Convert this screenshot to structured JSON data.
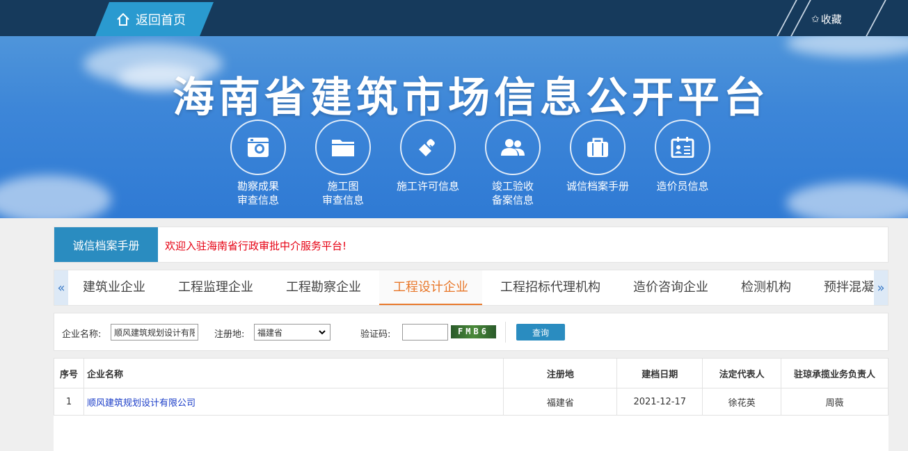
{
  "topbar": {
    "home_label": "返回首页",
    "favorite_label": "收藏"
  },
  "banner": {
    "title": "海南省建筑市场信息公开平台",
    "nav": [
      {
        "label": "勘察成果\n审查信息",
        "icon": "camera-icon"
      },
      {
        "label": "施工图\n审查信息",
        "icon": "folder-icon"
      },
      {
        "label": "施工许可信息",
        "icon": "stamp-icon"
      },
      {
        "label": "竣工验收\n备案信息",
        "icon": "users-icon"
      },
      {
        "label": "诚信档案手册",
        "icon": "briefcase-icon"
      },
      {
        "label": "造价员信息",
        "icon": "id-card-icon"
      }
    ]
  },
  "notice": {
    "tag": "诚信档案手册",
    "text": "欢迎入驻海南省行政审批中介服务平台!"
  },
  "tabs": {
    "prev": "«",
    "next": "»",
    "items": [
      "建筑业企业",
      "工程监理企业",
      "工程勘察企业",
      "工程设计企业",
      "工程招标代理机构",
      "造价咨询企业",
      "检测机构",
      "预拌混凝"
    ],
    "active_index": 3
  },
  "search": {
    "company_label": "企业名称:",
    "company_value": "顺风建筑规划设计有限",
    "region_label": "注册地:",
    "region_value": "福建省",
    "captcha_label": "验证码:",
    "captcha_value": "",
    "captcha_image_text": "FMB6",
    "query_label": "查询"
  },
  "table": {
    "headers": [
      "序号",
      "企业名称",
      "注册地",
      "建档日期",
      "法定代表人",
      "驻琼承揽业务负责人"
    ],
    "rows": [
      [
        "1",
        "顺风建筑规划设计有限公司",
        "福建省",
        "2021-12-17",
        "徐花英",
        "周薇"
      ]
    ]
  },
  "colors": {
    "topbar": "#163a5c",
    "accent": "#2a8cc0",
    "active_tab": "#e8782b",
    "notice": "#e60012",
    "link": "#1a3cc8"
  }
}
